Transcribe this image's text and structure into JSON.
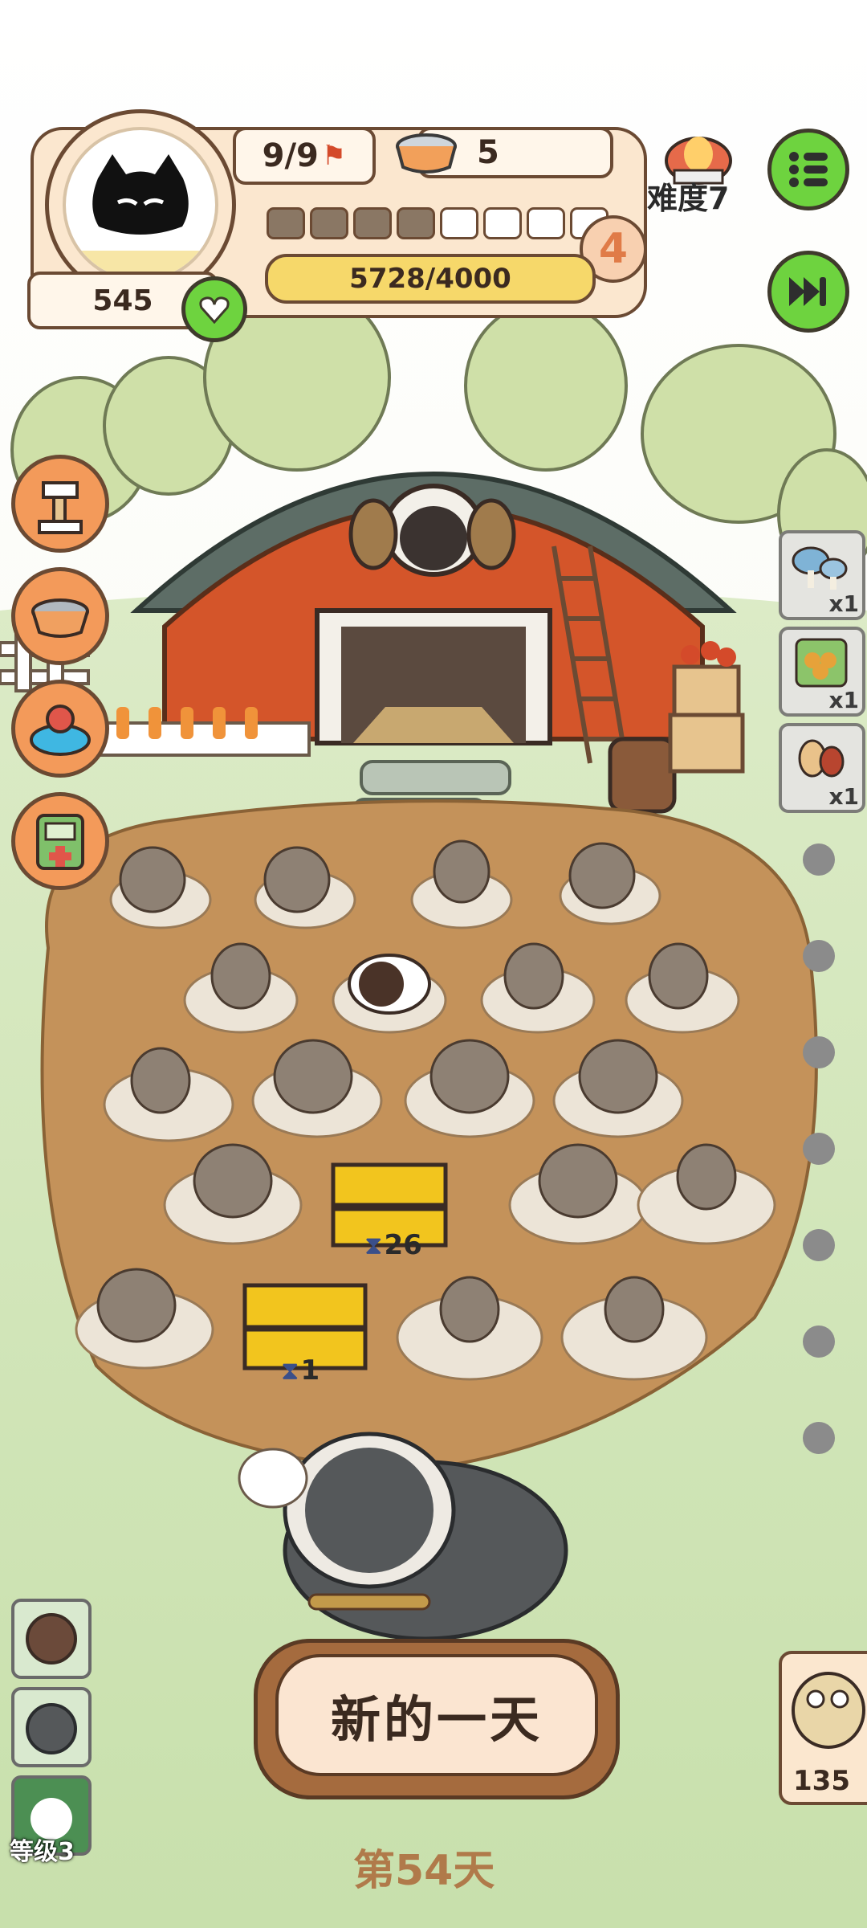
{
  "hud": {
    "profile_score": "545",
    "days_count": "9/9",
    "food_count": "5",
    "progress_text": "5728/4000",
    "level_badge": "4",
    "difficulty_label": "难度7",
    "segments_filled": 4,
    "segments_total": 8
  },
  "cages": {
    "timer_1": "26",
    "timer_2": "1"
  },
  "side_items": [
    {
      "name": "mushroom-item",
      "count": "x1"
    },
    {
      "name": "cookie-item",
      "count": "x1"
    },
    {
      "name": "peanut-item",
      "count": "x1"
    }
  ],
  "bottom": {
    "new_day_label": "新的一天",
    "day_label": "第54天",
    "level_label": "等级3",
    "mascot_count": "135"
  },
  "colors": {
    "accent_green": "#6ed33f",
    "panel_bg": "#fbe7cf",
    "barn_red": "#d4552a",
    "dirt": "#c4925a"
  }
}
